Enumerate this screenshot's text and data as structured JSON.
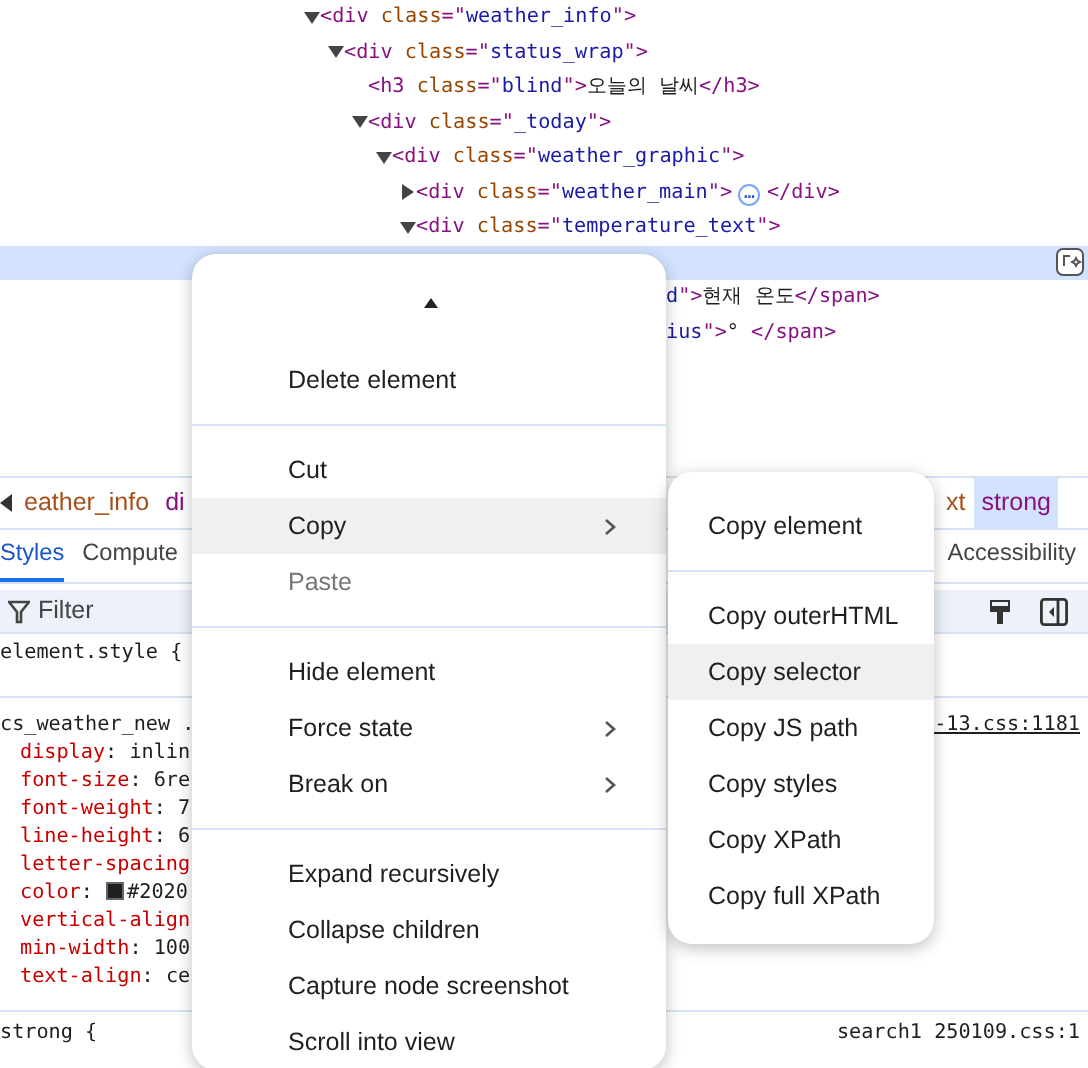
{
  "elements_tree": {
    "nodes": [
      {
        "expanded": true,
        "parts": [
          {
            "kind": "tag",
            "text": "<div "
          },
          {
            "kind": "attr",
            "text": "class"
          },
          {
            "kind": "punct",
            "text": "=\""
          },
          {
            "kind": "value",
            "text": "weather_info"
          },
          {
            "kind": "punct",
            "text": "\""
          },
          {
            "kind": "tag",
            "text": ">"
          }
        ],
        "children": [
          {
            "expanded": true,
            "parts": [
              {
                "kind": "tag",
                "text": "<div "
              },
              {
                "kind": "attr",
                "text": "class"
              },
              {
                "kind": "punct",
                "text": "=\""
              },
              {
                "kind": "value",
                "text": "status_wrap"
              },
              {
                "kind": "punct",
                "text": "\""
              },
              {
                "kind": "tag",
                "text": ">"
              }
            ],
            "children": [
              {
                "parts": [
                  {
                    "kind": "tag",
                    "text": "<h3 "
                  },
                  {
                    "kind": "attr",
                    "text": "class"
                  },
                  {
                    "kind": "punct",
                    "text": "=\""
                  },
                  {
                    "kind": "value",
                    "text": "blind"
                  },
                  {
                    "kind": "punct",
                    "text": "\""
                  },
                  {
                    "kind": "tag",
                    "text": ">"
                  },
                  {
                    "kind": "text",
                    "text": "오늘의 날씨"
                  },
                  {
                    "kind": "tag",
                    "text": "</h3>"
                  }
                ]
              },
              {
                "expanded": true,
                "parts": [
                  {
                    "kind": "tag",
                    "text": "<div "
                  },
                  {
                    "kind": "attr",
                    "text": "class"
                  },
                  {
                    "kind": "punct",
                    "text": "=\""
                  },
                  {
                    "kind": "value",
                    "text": "_today"
                  },
                  {
                    "kind": "punct",
                    "text": "\""
                  },
                  {
                    "kind": "tag",
                    "text": ">"
                  }
                ],
                "children": [
                  {
                    "expanded": true,
                    "parts": [
                      {
                        "kind": "tag",
                        "text": "<div "
                      },
                      {
                        "kind": "attr",
                        "text": "class"
                      },
                      {
                        "kind": "punct",
                        "text": "=\""
                      },
                      {
                        "kind": "value",
                        "text": "weather_graphic"
                      },
                      {
                        "kind": "punct",
                        "text": "\""
                      },
                      {
                        "kind": "tag",
                        "text": ">"
                      }
                    ],
                    "children": [
                      {
                        "expanded": false,
                        "parts": [
                          {
                            "kind": "tag",
                            "text": "<div "
                          },
                          {
                            "kind": "attr",
                            "text": "class"
                          },
                          {
                            "kind": "punct",
                            "text": "=\""
                          },
                          {
                            "kind": "value",
                            "text": "weather_main"
                          },
                          {
                            "kind": "punct",
                            "text": "\""
                          },
                          {
                            "kind": "tag",
                            "text": ">"
                          },
                          {
                            "kind": "ellipsis",
                            "text": "…"
                          },
                          {
                            "kind": "tag",
                            "text": "</div>"
                          }
                        ]
                      },
                      {
                        "expanded": true,
                        "parts": [
                          {
                            "kind": "tag",
                            "text": "<div "
                          },
                          {
                            "kind": "attr",
                            "text": "class"
                          },
                          {
                            "kind": "punct",
                            "text": "=\""
                          },
                          {
                            "kind": "value",
                            "text": "temperature_text"
                          },
                          {
                            "kind": "punct",
                            "text": "\""
                          },
                          {
                            "kind": "tag",
                            "text": ">"
                          }
                        ],
                        "children": [
                          {
                            "selected": true,
                            "children": [
                              {
                                "cut": true,
                                "parts": [
                                  {
                                    "kind": "value",
                                    "text": "d"
                                  },
                                  {
                                    "kind": "punct",
                                    "text": "\""
                                  },
                                  {
                                    "kind": "tag",
                                    "text": ">"
                                  },
                                  {
                                    "kind": "text",
                                    "text": "현재 온도"
                                  },
                                  {
                                    "kind": "tag",
                                    "text": "</span>"
                                  }
                                ]
                              },
                              {
                                "cut": true,
                                "parts": [
                                  {
                                    "kind": "value",
                                    "text": "ius"
                                  },
                                  {
                                    "kind": "punct",
                                    "text": "\""
                                  },
                                  {
                                    "kind": "tag",
                                    "text": ">"
                                  },
                                  {
                                    "kind": "text",
                                    "text": "° "
                                  },
                                  {
                                    "kind": "tag",
                                    "text": "</span>"
                                  }
                                ]
                              }
                            ]
                          }
                        ]
                      }
                    ]
                  }
                ]
              }
            ]
          }
        ]
      }
    ]
  },
  "breadcrumbs": {
    "left": [
      {
        "text": "eather_info",
        "kind": "class",
        "selected": false
      },
      {
        "text": "di",
        "kind": "tag",
        "selected": false
      }
    ],
    "right": [
      {
        "text": "xt",
        "kind": "class",
        "selected": false
      },
      {
        "text": "strong",
        "kind": "tag",
        "selected": true
      }
    ]
  },
  "tabs": [
    {
      "label": "Styles",
      "selected": true
    },
    {
      "label": "Compute",
      "selected": false
    },
    {
      "label": "Accessibility",
      "selected": false
    }
  ],
  "filter": {
    "placeholder": "Filter"
  },
  "rules": [
    {
      "selector": "element.style {"
    },
    {
      "selector": "cs_weather_new .",
      "source": "-13.css:1181",
      "properties": [
        {
          "name": "display",
          "punct": ":",
          "value": "inlin"
        },
        {
          "name": "font-size",
          "punct": ":",
          "value": "6re"
        },
        {
          "name": "font-weight",
          "punct": ":",
          "value": "7"
        },
        {
          "name": "line-height",
          "punct": ":",
          "value": "6"
        },
        {
          "name": "letter-spacing"
        },
        {
          "name": "color",
          "punct": ":",
          "value": "#2020",
          "kind": "color"
        },
        {
          "name": "vertical-align"
        },
        {
          "name": "min-width",
          "punct": ":",
          "value": "100"
        },
        {
          "name": "text-align",
          "punct": ":",
          "value": "ce"
        }
      ]
    },
    {
      "selector": "strong {",
      "source": "search1 250109.css:1"
    }
  ],
  "context_menu": {
    "items": [
      {
        "kind": "item",
        "label": "Delete element",
        "selected": false,
        "disabled": false
      },
      {
        "kind": "separator"
      },
      {
        "kind": "item",
        "label": "Cut",
        "selected": false,
        "disabled": false
      },
      {
        "kind": "item",
        "label": "Copy",
        "selected": true,
        "disabled": false,
        "submenu": true
      },
      {
        "kind": "item",
        "label": "Paste",
        "selected": false,
        "disabled": true
      },
      {
        "kind": "separator"
      },
      {
        "kind": "item",
        "label": "Hide element",
        "selected": false,
        "disabled": false
      },
      {
        "kind": "item",
        "label": "Force state",
        "selected": false,
        "disabled": false,
        "submenu": true
      },
      {
        "kind": "item",
        "label": "Break on",
        "selected": false,
        "disabled": false,
        "submenu": true
      },
      {
        "kind": "separator"
      },
      {
        "kind": "item",
        "label": "Expand recursively",
        "selected": false,
        "disabled": false
      },
      {
        "kind": "item",
        "label": "Collapse children",
        "selected": false,
        "disabled": false
      },
      {
        "kind": "item",
        "label": "Capture node screenshot",
        "selected": false,
        "disabled": false
      },
      {
        "kind": "item",
        "label": "Scroll into view",
        "selected": false,
        "disabled": false
      }
    ]
  },
  "copy_submenu": {
    "items": [
      {
        "kind": "item",
        "label": "Copy element",
        "selected": false,
        "disabled": false
      },
      {
        "kind": "separator"
      },
      {
        "kind": "item",
        "label": "Copy outerHTML",
        "selected": false,
        "disabled": false
      },
      {
        "kind": "item",
        "label": "Copy selector",
        "selected": true,
        "disabled": false
      },
      {
        "kind": "item",
        "label": "Copy JS path",
        "selected": false,
        "disabled": false
      },
      {
        "kind": "item",
        "label": "Copy styles",
        "selected": false,
        "disabled": false
      },
      {
        "kind": "item",
        "label": "Copy XPath",
        "selected": false,
        "disabled": false
      },
      {
        "kind": "item",
        "label": "Copy full XPath",
        "selected": false,
        "disabled": false
      }
    ]
  }
}
